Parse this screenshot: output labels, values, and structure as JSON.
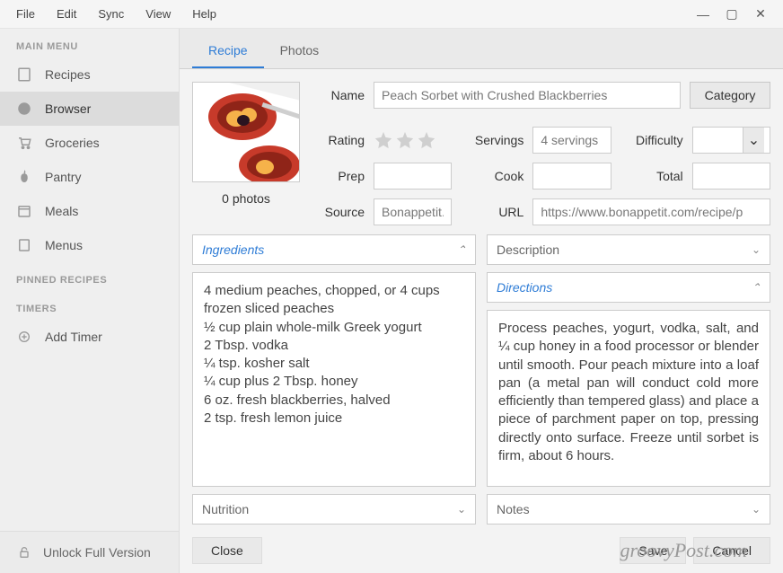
{
  "menubar": [
    "File",
    "Edit",
    "Sync",
    "View",
    "Help"
  ],
  "sidebar": {
    "main_label": "MAIN MENU",
    "items": [
      {
        "icon": "book",
        "label": "Recipes"
      },
      {
        "icon": "compass",
        "label": "Browser"
      },
      {
        "icon": "cart",
        "label": "Groceries"
      },
      {
        "icon": "apple",
        "label": "Pantry"
      },
      {
        "icon": "calendar",
        "label": "Meals"
      },
      {
        "icon": "list",
        "label": "Menus"
      }
    ],
    "pinned_label": "PINNED RECIPES",
    "timers_label": "TIMERS",
    "add_timer": "Add Timer",
    "unlock": "Unlock Full Version"
  },
  "tabs": [
    {
      "label": "Recipe",
      "active": true
    },
    {
      "label": "Photos",
      "active": false
    }
  ],
  "photos_count": "0 photos",
  "labels": {
    "name": "Name",
    "category": "Category",
    "rating": "Rating",
    "servings": "Servings",
    "difficulty": "Difficulty",
    "prep": "Prep",
    "cook": "Cook",
    "total": "Total",
    "source": "Source",
    "url": "URL"
  },
  "values": {
    "name": "Peach Sorbet with Crushed Blackberries",
    "servings": "4 servings",
    "difficulty": "",
    "prep": "",
    "cook": "",
    "total": "",
    "source": "Bonappetit.com",
    "url": "https://www.bonappetit.com/recipe/p"
  },
  "accordions": {
    "ingredients": "Ingredients",
    "description": "Description",
    "directions": "Directions",
    "nutrition": "Nutrition",
    "notes": "Notes"
  },
  "ingredients": [
    "4 medium peaches, chopped, or 4 cups frozen sliced peaches",
    "½ cup plain whole-milk Greek yogurt",
    "2 Tbsp. vodka",
    "¼ tsp. kosher salt",
    "¼ cup plus 2 Tbsp. honey",
    "6 oz. fresh blackberries, halved",
    "2 tsp. fresh lemon juice"
  ],
  "directions": "Process peaches, yogurt, vodka, salt, and ¼ cup honey in a food processor or blender until smooth. Pour peach mixture into a loaf pan (a metal pan will conduct cold more efficiently than tempered glass) and place a piece of parchment paper on top, pressing directly onto surface. Freeze until sorbet is firm, about 6 hours.",
  "footer": {
    "close": "Close",
    "save": "Save",
    "cancel": "Cancel"
  },
  "watermark": "groovyPost.com"
}
